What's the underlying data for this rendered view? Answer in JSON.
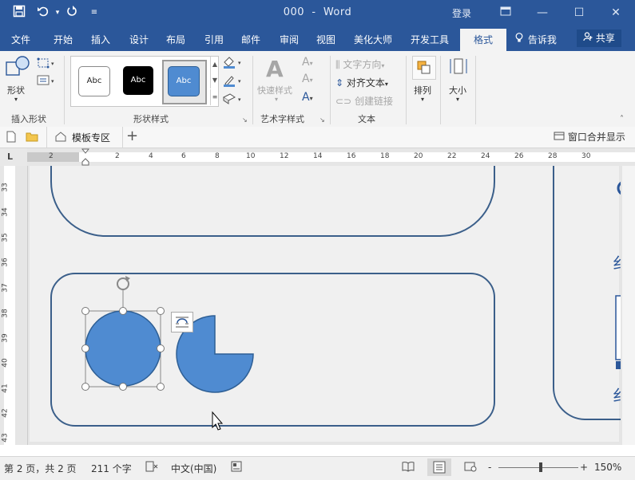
{
  "window": {
    "doc_name": "000",
    "app_name": "Word",
    "title_separator": "-",
    "login": "登录"
  },
  "menu": {
    "tabs": [
      "文件",
      "开始",
      "插入",
      "设计",
      "布局",
      "引用",
      "邮件",
      "审阅",
      "视图",
      "美化大师",
      "开发工具"
    ],
    "active_tab": "格式",
    "tell_me": "告诉我",
    "share": "共享"
  },
  "ribbon": {
    "insert_shapes": {
      "shapes_label": "形状",
      "group_label": "插入形状"
    },
    "shape_styles": {
      "chips": [
        "Abc",
        "Abc",
        "Abc"
      ],
      "group_label": "形状样式"
    },
    "wordart": {
      "quick_styles": "快速样式",
      "group_label": "艺术字样式",
      "a_glyph": "A"
    },
    "text": {
      "direction": "文字方向",
      "align": "对齐文本",
      "link": "创建链接",
      "group_label": "文本"
    },
    "arrange": {
      "label": "排列"
    },
    "size": {
      "label": "大小"
    }
  },
  "tabstrip": {
    "template_zone": "模板专区",
    "plus": "+",
    "merge_windows": "窗口合并显示"
  },
  "ruler": {
    "h_ticks": [
      "2",
      "2",
      "4",
      "6",
      "8",
      "10",
      "12",
      "14",
      "16",
      "18",
      "20",
      "22",
      "24",
      "26",
      "28",
      "30"
    ],
    "v_ticks": [
      "33",
      "34",
      "35",
      "36",
      "37",
      "38",
      "39",
      "40",
      "41",
      "42",
      "43"
    ]
  },
  "document": {
    "right_fragments": [
      "纟",
      "纟"
    ]
  },
  "status": {
    "page": "第 2 页，共 2 页",
    "words": "211 个字",
    "language": "中文(中国)",
    "zoom": "150%",
    "zoom_minus": "-",
    "zoom_plus": "+"
  },
  "colors": {
    "title_blue": "#2b579a",
    "shape_fill": "#4f8bd1",
    "shape_stroke": "#2e5f95",
    "frame_stroke": "#3b5f8a"
  }
}
